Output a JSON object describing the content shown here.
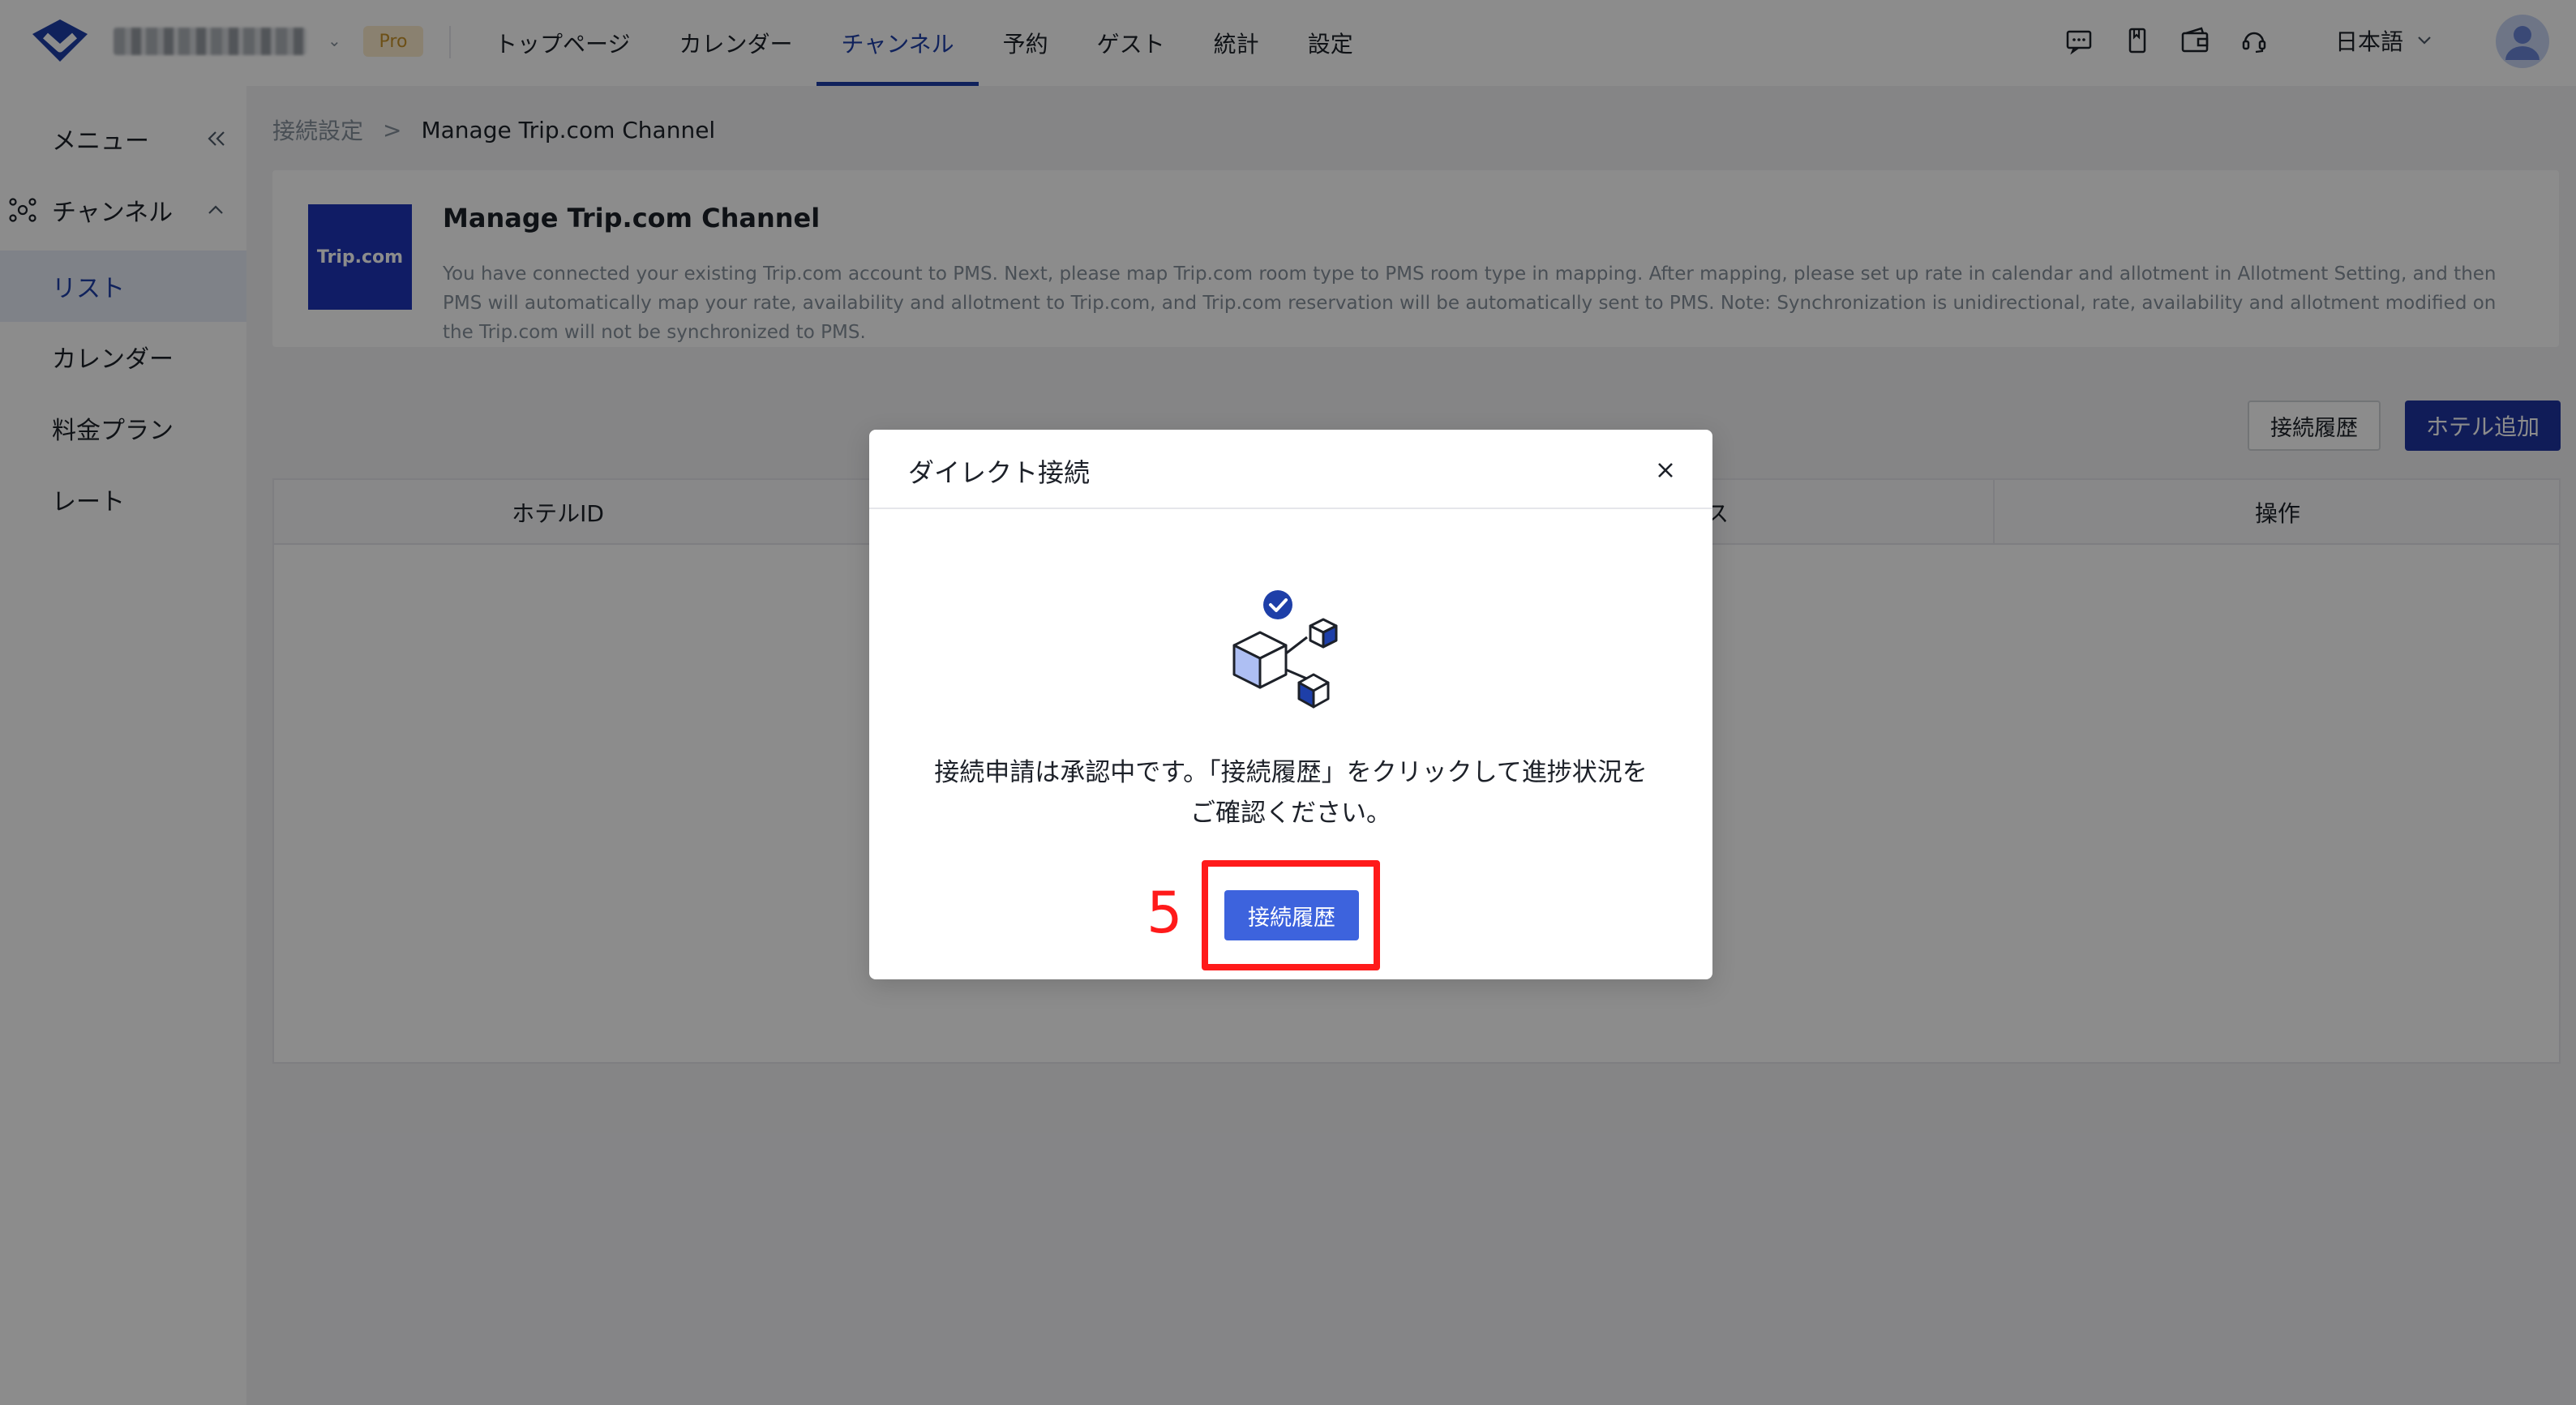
{
  "topbar": {
    "pro_label": "Pro",
    "hotel_caret": "⌄",
    "nav": [
      {
        "label": "トップページ",
        "active": false
      },
      {
        "label": "カレンダー",
        "active": false
      },
      {
        "label": "チャンネル",
        "active": true
      },
      {
        "label": "予約",
        "active": false
      },
      {
        "label": "ゲスト",
        "active": false
      },
      {
        "label": "統計",
        "active": false
      },
      {
        "label": "設定",
        "active": false
      }
    ],
    "icons": [
      "message-icon",
      "bookmark-icon",
      "wallet-icon",
      "headset-icon"
    ],
    "language": "日本語"
  },
  "sidebar": {
    "menu_label": "メニュー",
    "channel_label": "チャンネル",
    "items": [
      {
        "label": "リスト",
        "active": true
      },
      {
        "label": "カレンダー",
        "active": false
      },
      {
        "label": "料金プラン",
        "active": false
      },
      {
        "label": "レート",
        "active": false
      }
    ]
  },
  "breadcrumb": {
    "parent": "接続設定",
    "separator": ">",
    "current": "Manage Trip.com Channel"
  },
  "channel_card": {
    "logo_text": "Trip.com",
    "title": "Manage Trip.com Channel",
    "description": "You have connected your existing Trip.com account to PMS. Next, please map Trip.com room type to PMS room type in mapping. After mapping, please set up rate in calendar and allotment in Allotment Setting, and then PMS will automatically map your rate, availability and allotment to Trip.com, and Trip.com reservation will be automatically sent to PMS. Note: Synchronization is unidirectional, rate, availability and allotment modified on the Trip.com will not be synchronized to PMS."
  },
  "actions": {
    "history_label": "接続履歴",
    "add_hotel_label": "ホテル追加"
  },
  "table": {
    "columns": [
      "ホテルID",
      "ータス",
      "操作"
    ]
  },
  "modal": {
    "title": "ダイレクト接続",
    "message_line1": "接続申請は承認中です。「接続履歴」をクリックして進捗状況を",
    "message_line2": "ご確認ください。",
    "button_label": "接続履歴"
  },
  "annotation": {
    "step_number": "5"
  },
  "colors": {
    "primary": "#1e3fa8",
    "modal_button": "#3d63dd",
    "highlight": "#ff1a1a",
    "pro_badge_bg": "#fbeccd",
    "trip_logo_bg": "#1e33b8"
  }
}
